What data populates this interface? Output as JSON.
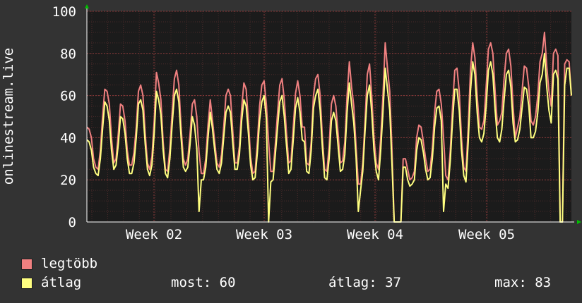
{
  "chart_data": {
    "type": "line",
    "ylabel": "onlinestream.live",
    "ylim": [
      0,
      100
    ],
    "yticks": [
      0,
      20,
      40,
      60,
      80,
      100
    ],
    "xticks": [
      "Week 02",
      "Week 03",
      "Week 04",
      "Week 05"
    ],
    "grid": true,
    "colors": {
      "background": "#333333",
      "plot": "#1b1b1b",
      "grid": "#5a2e2e",
      "axis_marker": "#00c000"
    },
    "x_note": "sample index, ~5 per day over ~5 weeks",
    "series": [
      {
        "name": "legtöbb",
        "color": "#f08080",
        "values": [
          45,
          44,
          40,
          30,
          26,
          25,
          34,
          50,
          63,
          62,
          56,
          40,
          28,
          30,
          42,
          56,
          55,
          48,
          34,
          27,
          27,
          33,
          45,
          62,
          65,
          60,
          42,
          28,
          25,
          31,
          48,
          71,
          66,
          58,
          38,
          25,
          24,
          35,
          52,
          68,
          72,
          65,
          45,
          30,
          27,
          30,
          42,
          56,
          58,
          50,
          33,
          23,
          23,
          30,
          46,
          58,
          48,
          38,
          28,
          26,
          32,
          45,
          60,
          63,
          60,
          44,
          28,
          28,
          36,
          54,
          66,
          63,
          48,
          31,
          23,
          24,
          38,
          55,
          65,
          67,
          56,
          38,
          24,
          24,
          37,
          52,
          65,
          68,
          58,
          42,
          28,
          29,
          45,
          61,
          67,
          60,
          45,
          45,
          28,
          27,
          38,
          60,
          68,
          70,
          60,
          40,
          25,
          24,
          36,
          56,
          60,
          55,
          42,
          28,
          29,
          38,
          60,
          76,
          64,
          55,
          36,
          18,
          18,
          28,
          48,
          70,
          75,
          60,
          40,
          28,
          25,
          40,
          60,
          85,
          73,
          62,
          35,
          0,
          0,
          0,
          0,
          30,
          30,
          25,
          20,
          21,
          24,
          40,
          46,
          45,
          38,
          30,
          24,
          25,
          35,
          52,
          62,
          63,
          56,
          40,
          22,
          20,
          34,
          55,
          72,
          73,
          62,
          40,
          26,
          24,
          45,
          72,
          85,
          78,
          60,
          45,
          44,
          48,
          64,
          82,
          85,
          80,
          62,
          46,
          48,
          52,
          68,
          80,
          82,
          74,
          55,
          40,
          45,
          50,
          62,
          74,
          73,
          64,
          48,
          46,
          50,
          60,
          76,
          80,
          90,
          74,
          62,
          55,
          80,
          82,
          79,
          0,
          0,
          75,
          77,
          76,
          60
        ]
      },
      {
        "name": "átlag",
        "color": "#ffff80",
        "values": [
          39,
          38,
          34,
          26,
          23,
          22,
          30,
          44,
          57,
          55,
          48,
          34,
          25,
          27,
          37,
          50,
          49,
          42,
          30,
          23,
          23,
          28,
          40,
          56,
          58,
          53,
          37,
          25,
          22,
          27,
          42,
          62,
          58,
          51,
          34,
          23,
          21,
          30,
          46,
          60,
          63,
          57,
          40,
          26,
          24,
          26,
          37,
          50,
          46,
          35,
          5,
          20,
          20,
          26,
          40,
          52,
          44,
          34,
          25,
          23,
          28,
          40,
          52,
          55,
          52,
          38,
          25,
          25,
          32,
          48,
          58,
          55,
          42,
          27,
          20,
          21,
          33,
          48,
          57,
          60,
          49,
          0,
          19,
          20,
          32,
          45,
          57,
          60,
          50,
          36,
          23,
          25,
          39,
          54,
          59,
          52,
          39,
          38,
          24,
          23,
          34,
          54,
          60,
          63,
          53,
          35,
          21,
          20,
          30,
          48,
          52,
          48,
          36,
          24,
          25,
          32,
          52,
          66,
          56,
          47,
          31,
          5,
          15,
          24,
          43,
          60,
          65,
          52,
          34,
          24,
          20,
          34,
          52,
          73,
          63,
          53,
          28,
          0,
          0,
          0,
          0,
          26,
          26,
          20,
          17,
          18,
          20,
          34,
          40,
          39,
          33,
          25,
          20,
          21,
          30,
          45,
          54,
          55,
          48,
          5,
          18,
          16,
          29,
          48,
          63,
          63,
          53,
          34,
          22,
          19,
          38,
          62,
          76,
          70,
          52,
          40,
          38,
          42,
          55,
          72,
          76,
          70,
          53,
          40,
          38,
          44,
          58,
          70,
          72,
          64,
          47,
          38,
          39,
          44,
          54,
          64,
          63,
          55,
          40,
          40,
          43,
          52,
          66,
          70,
          80,
          64,
          53,
          47,
          70,
          72,
          68,
          0,
          0,
          65,
          73,
          73,
          60
        ]
      }
    ]
  },
  "legend": [
    {
      "label": "legtöbb",
      "color": "#f08080"
    },
    {
      "label": "átlag",
      "color": "#ffff80"
    }
  ],
  "stats": {
    "now": "most: 60",
    "avg": "átlag: 37",
    "max": "max: 83"
  }
}
